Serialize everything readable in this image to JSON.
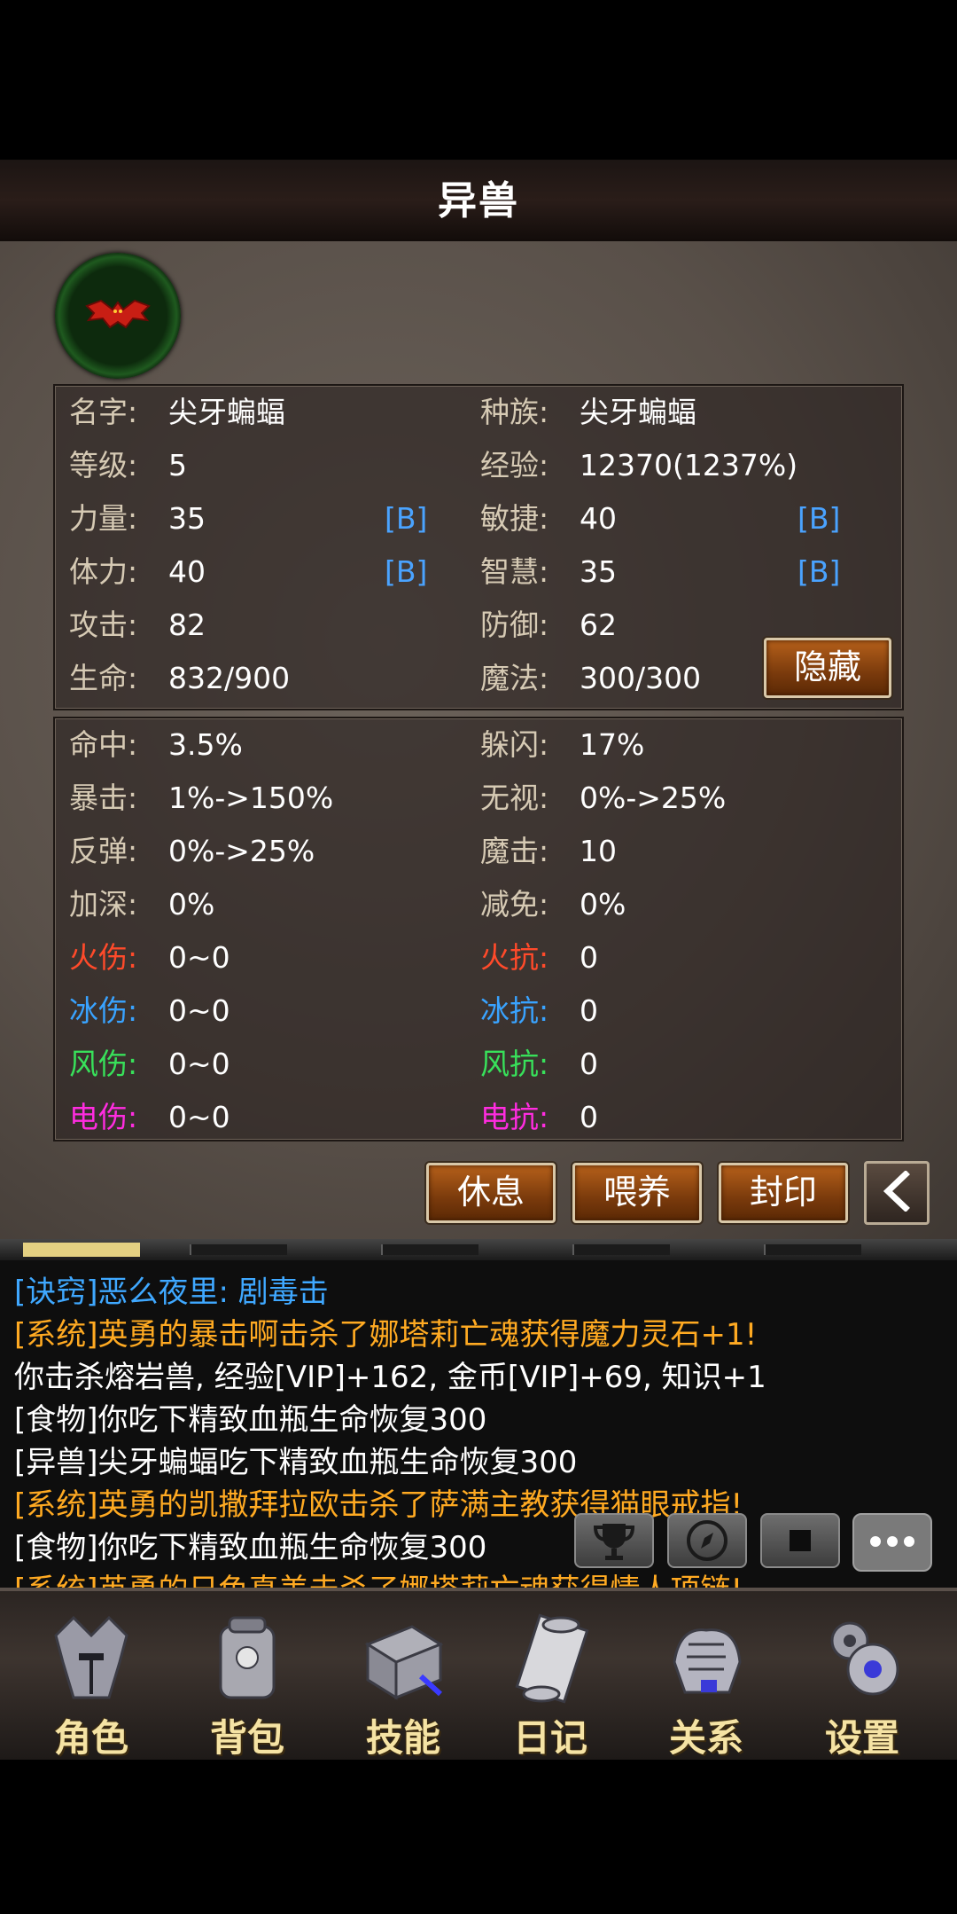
{
  "header": {
    "title": "异兽"
  },
  "pet": {
    "icon": "bat-icon",
    "stats": [
      {
        "label": "名字:",
        "value": "尖牙蝙蝠",
        "label2": "种族:",
        "value2": "尖牙蝙蝠"
      },
      {
        "label": "等级:",
        "value": "5",
        "label2": "经验:",
        "value2": "12370(1237%)"
      },
      {
        "label": "力量:",
        "value": "35",
        "grade": "[B]",
        "label2": "敏捷:",
        "value2": "40",
        "grade2": "[B]"
      },
      {
        "label": "体力:",
        "value": "40",
        "grade": "[B]",
        "label2": "智慧:",
        "value2": "35",
        "grade2": "[B]"
      },
      {
        "label": "攻击:",
        "value": "82",
        "label2": "防御:",
        "value2": "62"
      },
      {
        "label": "生命:",
        "value": "832/900",
        "label2": "魔法:",
        "value2": "300/300"
      }
    ],
    "hide_button": "隐藏",
    "combat": [
      {
        "label": "命中:",
        "value": "3.5%",
        "label2": "躲闪:",
        "value2": "17%"
      },
      {
        "label": "暴击:",
        "value": "1%->150%",
        "label2": "无视:",
        "value2": "0%->25%"
      },
      {
        "label": "反弹:",
        "value": "0%->25%",
        "label2": "魔击:",
        "value2": "10"
      },
      {
        "label": "加深:",
        "value": "0%",
        "label2": "减免:",
        "value2": "0%"
      },
      {
        "label": "火伤:",
        "value": "0~0",
        "label2": "火抗:",
        "value2": "0"
      },
      {
        "label": "冰伤:",
        "value": "0~0",
        "label2": "冰抗:",
        "value2": "0"
      },
      {
        "label": "风伤:",
        "value": "0~0",
        "label2": "风抗:",
        "value2": "0"
      },
      {
        "label": "电伤:",
        "value": "0~0",
        "label2": "电抗:",
        "value2": "0"
      }
    ]
  },
  "actions": {
    "rest": "休息",
    "feed": "喂养",
    "seal": "封印",
    "back_icon": "chevron-left-icon"
  },
  "colors": {
    "fire": "#ff4a2a",
    "ice": "#39a3ff",
    "wind": "#38e05a",
    "electric": "#ff2ce0",
    "grade": "#4aa3ff"
  },
  "log": [
    {
      "text": "[诀窍]恶么夜里: 剧毒击",
      "color": "blue"
    },
    {
      "text": "[系统]英勇的暴击啊击杀了娜塔莉亡魂获得魔力灵石+1!",
      "color": "orange"
    },
    {
      "text": "你击杀熔岩兽, 经验[VIP]+162, 金币[VIP]+69, 知识+1",
      "color": "white"
    },
    {
      "text": "[食物]你吃下精致血瓶生命恢复300",
      "color": "white"
    },
    {
      "text": "[异兽]尖牙蝙蝠吃下精致血瓶生命恢复300",
      "color": "white"
    },
    {
      "text": "[系统]英勇的凯撒拜拉欧击杀了萨满主教获得猫眼戒指!",
      "color": "orange"
    },
    {
      "text": "[食物]你吃下精致血瓶生命恢复300",
      "color": "white"
    },
    {
      "text": "[系统]英勇的日色真美击杀了娜塔莉亡魂获得情人项链!",
      "color": "orange"
    }
  ],
  "quick_buttons": [
    "trophy-icon",
    "compass-icon",
    "square-icon",
    "chat-bubble-icon"
  ],
  "nav": [
    {
      "label": "角色",
      "icon": "helmet-icon"
    },
    {
      "label": "背包",
      "icon": "backpack-icon"
    },
    {
      "label": "技能",
      "icon": "spellbook-icon"
    },
    {
      "label": "日记",
      "icon": "scroll-icon"
    },
    {
      "label": "关系",
      "icon": "gauntlet-icon"
    },
    {
      "label": "设置",
      "icon": "gear-icon"
    }
  ]
}
